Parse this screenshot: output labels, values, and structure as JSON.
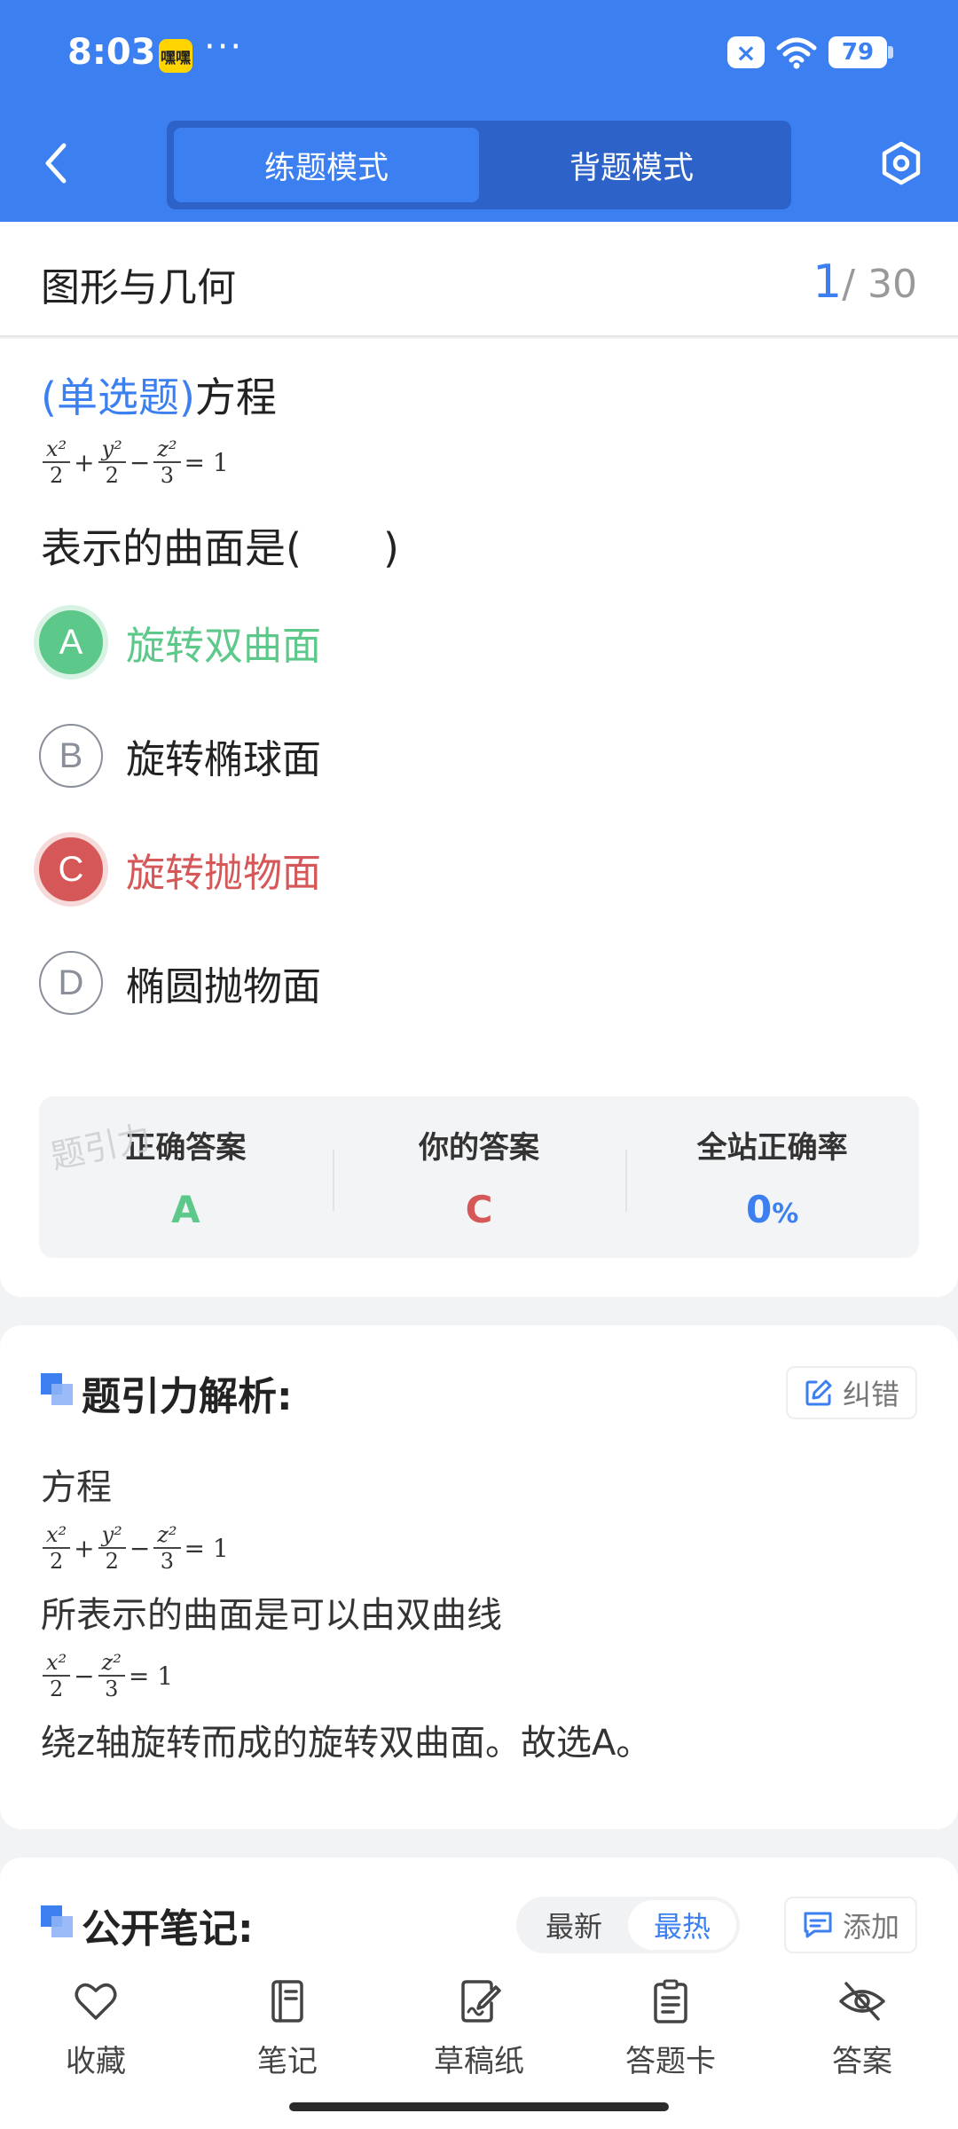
{
  "status_bar": {
    "time": "8:03",
    "app_badge": "嘿嘿",
    "more": "···",
    "mute": "×",
    "battery": "79"
  },
  "header": {
    "tabs": [
      {
        "label": "练题模式",
        "active": true
      },
      {
        "label": "背题模式",
        "active": false
      }
    ]
  },
  "section": {
    "title": "图形与几何",
    "current": "1",
    "total": "/ 30"
  },
  "question": {
    "type_label": "(单选题)",
    "text_prefix": "方程",
    "formula": {
      "t1": "x²",
      "d1": "2",
      "plus": "+",
      "t2": "y²",
      "d2": "2",
      "minus": "−",
      "t3": "z²",
      "d3": "3",
      "eq": "= 1"
    },
    "text_suffix": "表示的曲面是(　　)",
    "options": [
      {
        "letter": "A",
        "text": "旋转双曲面",
        "state": "correct"
      },
      {
        "letter": "B",
        "text": "旋转椭球面",
        "state": "normal"
      },
      {
        "letter": "C",
        "text": "旋转抛物面",
        "state": "wrong"
      },
      {
        "letter": "D",
        "text": "椭圆抛物面",
        "state": "normal"
      }
    ]
  },
  "stats": {
    "watermark": "题引力",
    "correct_label": "正确答案",
    "correct_value": "A",
    "your_label": "你的答案",
    "your_value": "C",
    "rate_label": "全站正确率",
    "rate_value": "0",
    "rate_unit": "%"
  },
  "analysis": {
    "title": "题引力解析:",
    "fix_label": "纠错",
    "line1": "方程",
    "line2": "所表示的曲面是可以由双曲线",
    "formula2": {
      "t1": "x²",
      "d1": "2",
      "minus": "−",
      "t2": "z²",
      "d2": "3",
      "eq": "= 1"
    },
    "line3": "绕z轴旋转而成的旋转双曲面。故选A。"
  },
  "notes": {
    "title": "公开笔记:",
    "sort_new": "最新",
    "sort_hot": "最热",
    "add_label": "添加"
  },
  "bottom_nav": [
    {
      "label": "收藏",
      "icon": "heart-icon"
    },
    {
      "label": "笔记",
      "icon": "notebook-icon"
    },
    {
      "label": "草稿纸",
      "icon": "draft-icon"
    },
    {
      "label": "答题卡",
      "icon": "answer-sheet-icon"
    },
    {
      "label": "答案",
      "icon": "eye-off-icon"
    }
  ],
  "colors": {
    "accent": "#3b7ff0",
    "correct": "#5cc98a",
    "wrong": "#d65757"
  }
}
